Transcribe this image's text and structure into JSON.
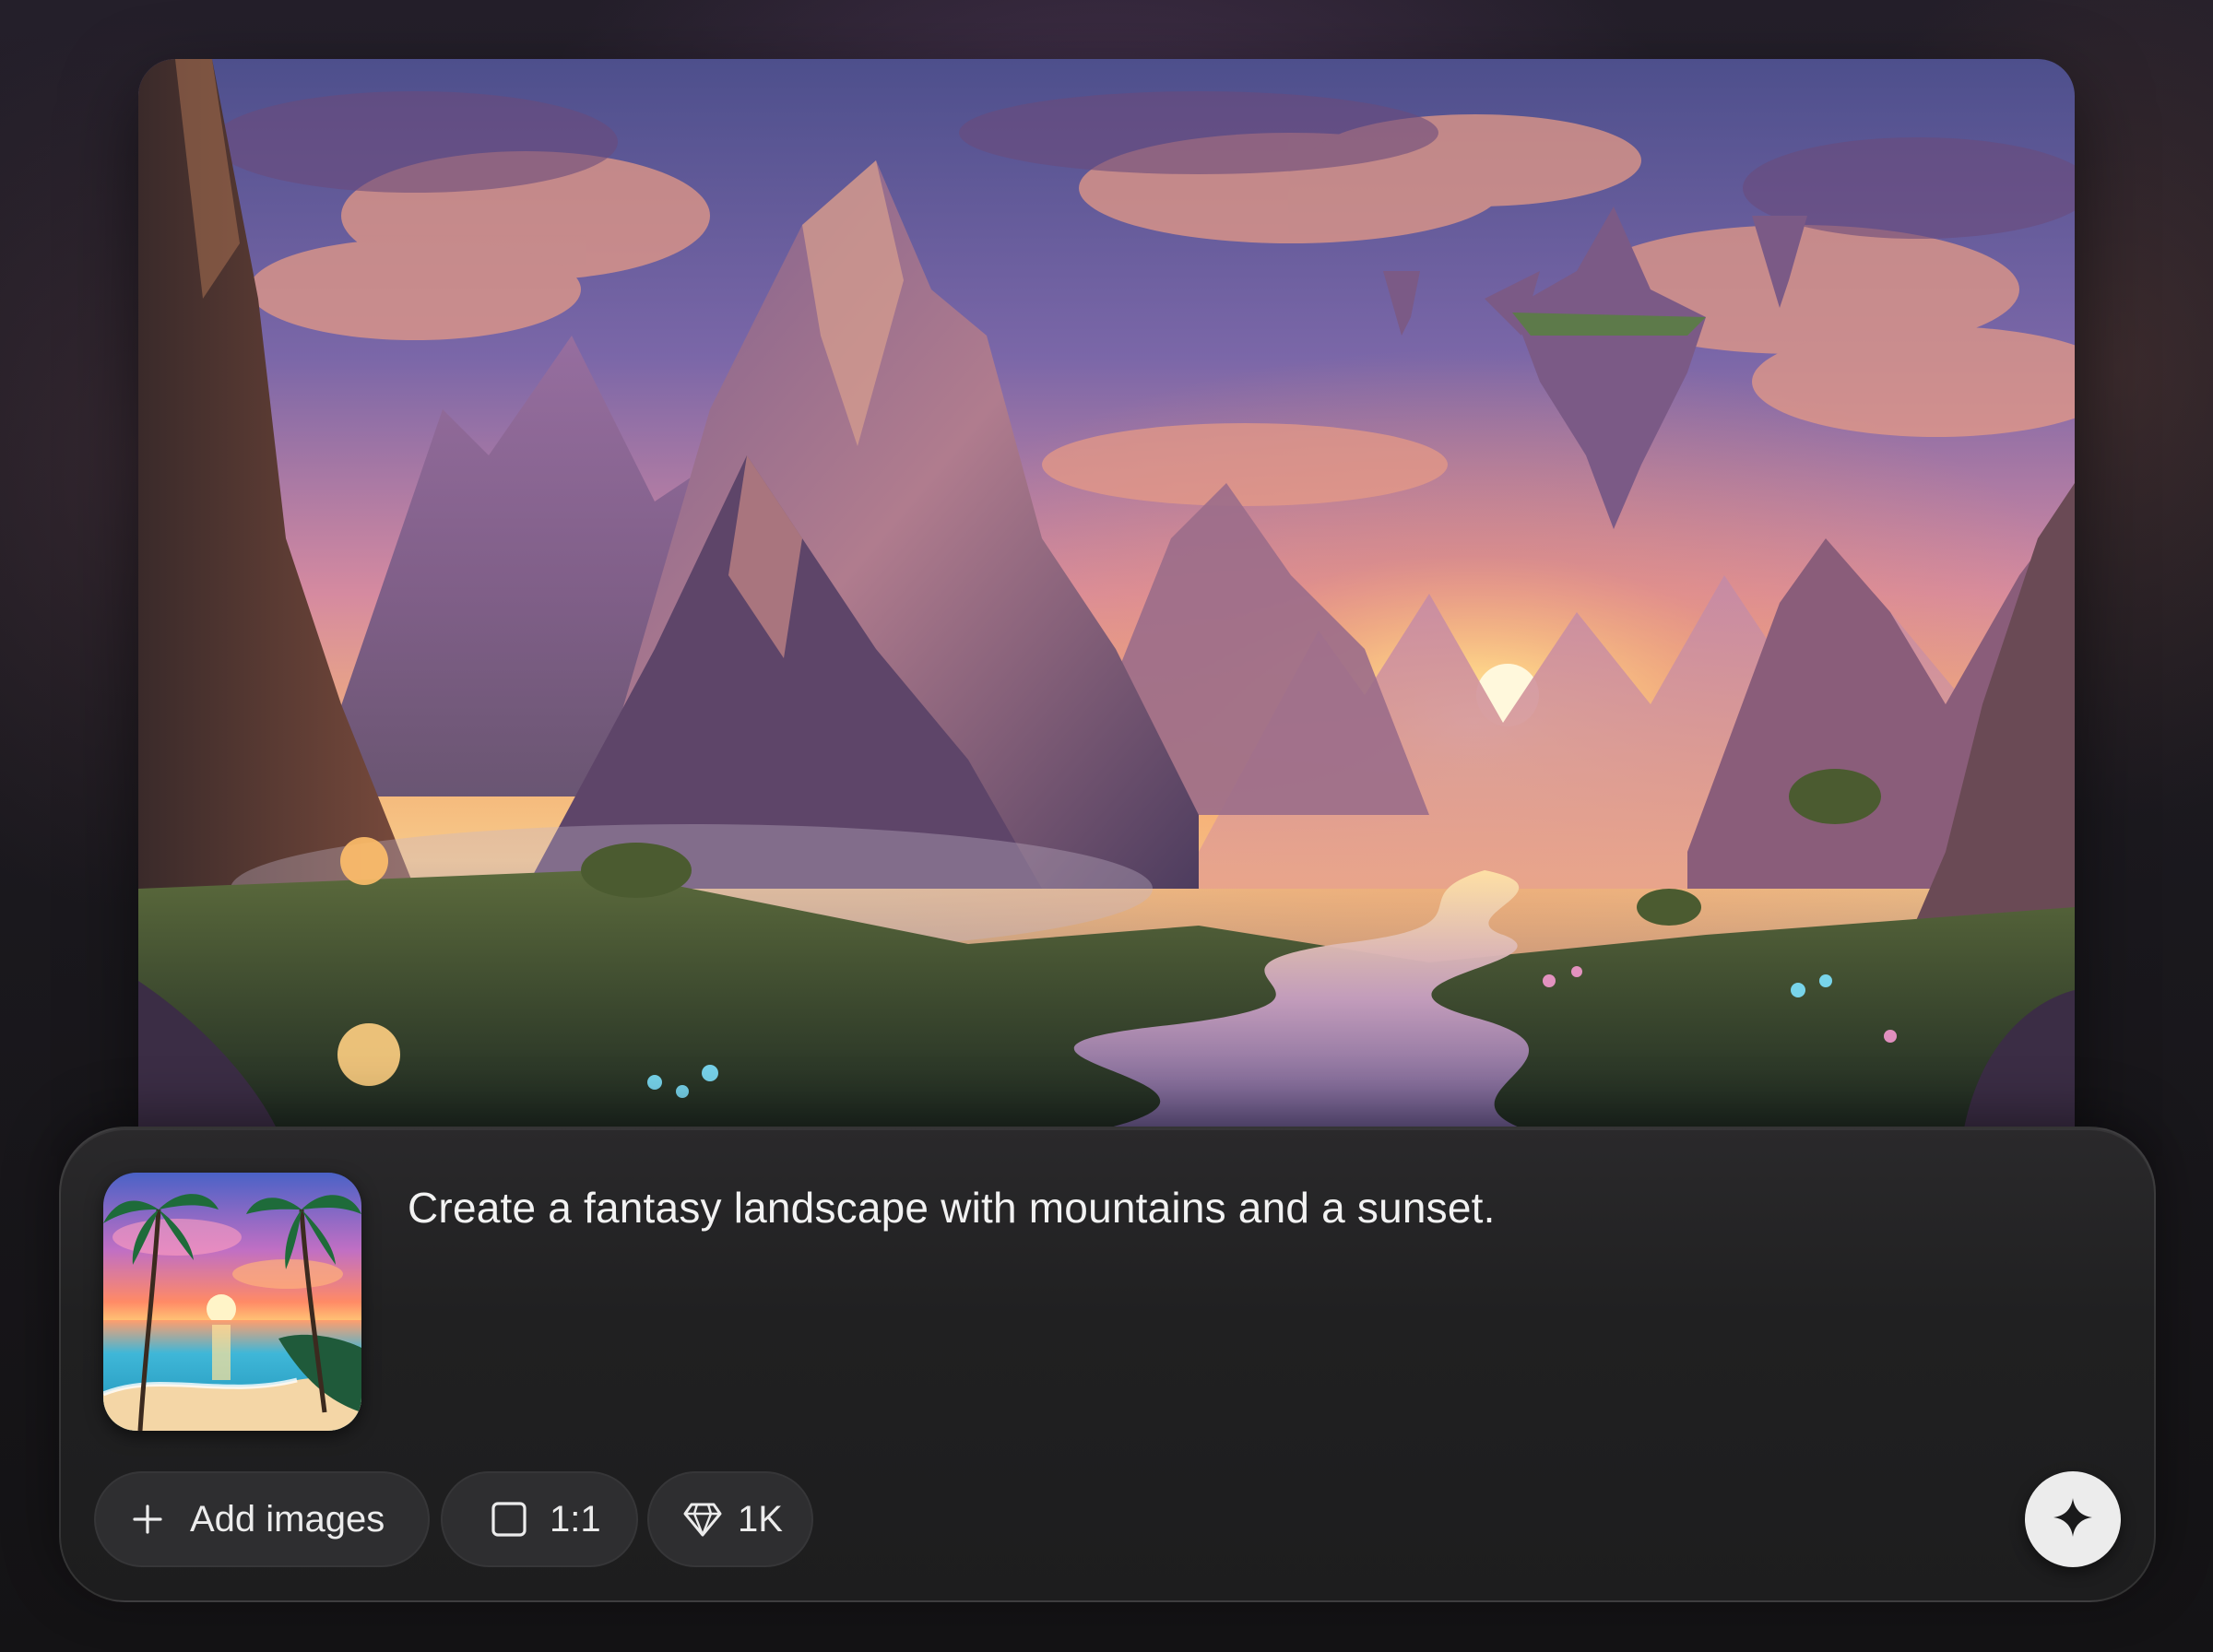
{
  "prompt": {
    "text": "Create a fantasy landscape with mountains and a sunset."
  },
  "reference_image": {
    "icon": "tropical-beach-sunset-thumbnail"
  },
  "generated_image": {
    "icon": "fantasy-mountain-sunset-landscape"
  },
  "toolbar": {
    "add_images_label": "Add images",
    "aspect_ratio_label": "1:1",
    "resolution_label": "1K",
    "generate_icon": "sparkle-icon"
  },
  "colors": {
    "page_background": "#151416",
    "panel_background": "#202021",
    "pill_background": "#2e2e30",
    "generate_button": "#ececec",
    "text": "#f2f2f2"
  }
}
